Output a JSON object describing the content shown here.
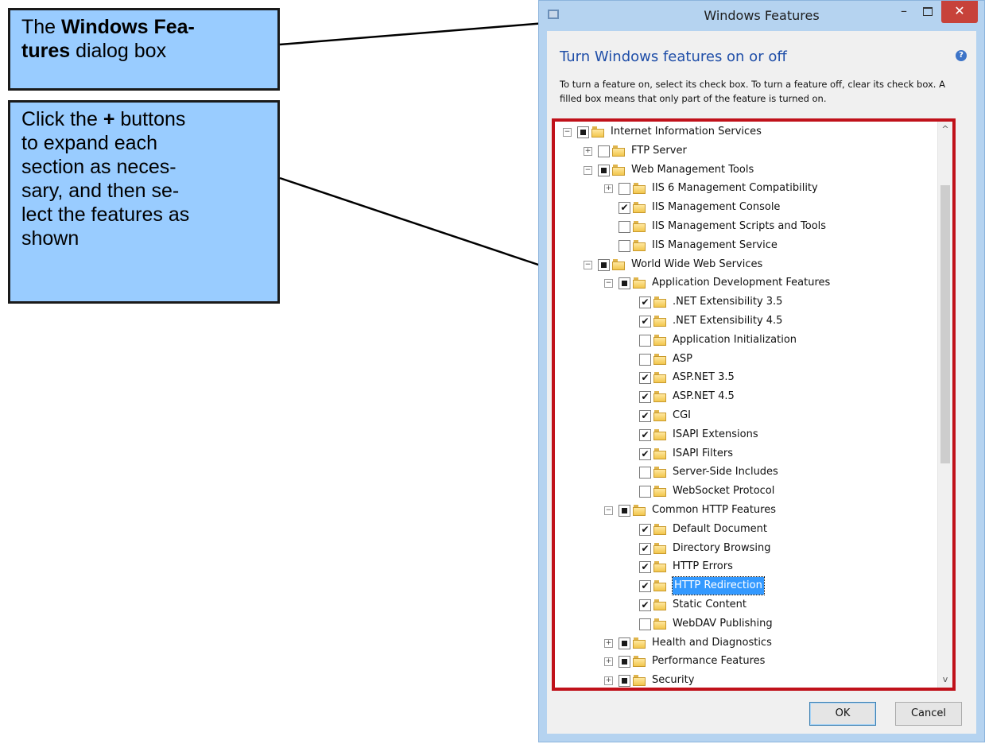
{
  "callouts": [
    {
      "pre": "The ",
      "bold": "Windows Fea-",
      "line2_bold": "tures",
      "post": " dialog box"
    },
    {
      "pre": "Click the ",
      "bold": "+",
      "post": " buttons",
      "lines": [
        "to expand each",
        "section as neces-",
        "sary, and then se-",
        "lect the features as",
        "shown"
      ]
    }
  ],
  "window": {
    "title": "Windows Features",
    "minimize_glyph": "–",
    "close_glyph": "✕",
    "heading": "Turn Windows features on or off",
    "help_glyph": "?",
    "description": "To turn a feature on, select its check box. To turn a feature off, clear its check box. A filled box means that only part of the feature is turned on.",
    "ok_label": "OK",
    "cancel_label": "Cancel"
  },
  "scroll": {
    "up": "^",
    "down": "v"
  },
  "tree": [
    {
      "label": "Internet Information Services",
      "level": 0,
      "expander": "−",
      "check": "partial"
    },
    {
      "label": "FTP Server",
      "level": 1,
      "expander": "+",
      "check": "unchecked"
    },
    {
      "label": "Web Management Tools",
      "level": 1,
      "expander": "−",
      "check": "partial"
    },
    {
      "label": "IIS 6 Management Compatibility",
      "level": 2,
      "expander": "+",
      "check": "unchecked"
    },
    {
      "label": "IIS Management Console",
      "level": 2,
      "expander": "",
      "check": "checked"
    },
    {
      "label": "IIS Management Scripts and Tools",
      "level": 2,
      "expander": "",
      "check": "unchecked"
    },
    {
      "label": "IIS Management Service",
      "level": 2,
      "expander": "",
      "check": "unchecked"
    },
    {
      "label": "World Wide Web Services",
      "level": 1,
      "expander": "−",
      "check": "partial"
    },
    {
      "label": "Application Development Features",
      "level": 2,
      "expander": "−",
      "check": "partial"
    },
    {
      "label": ".NET Extensibility 3.5",
      "level": 3,
      "expander": "",
      "check": "checked"
    },
    {
      "label": ".NET Extensibility 4.5",
      "level": 3,
      "expander": "",
      "check": "checked"
    },
    {
      "label": "Application Initialization",
      "level": 3,
      "expander": "",
      "check": "unchecked"
    },
    {
      "label": "ASP",
      "level": 3,
      "expander": "",
      "check": "unchecked"
    },
    {
      "label": "ASP.NET 3.5",
      "level": 3,
      "expander": "",
      "check": "checked"
    },
    {
      "label": "ASP.NET 4.5",
      "level": 3,
      "expander": "",
      "check": "checked"
    },
    {
      "label": "CGI",
      "level": 3,
      "expander": "",
      "check": "checked"
    },
    {
      "label": "ISAPI Extensions",
      "level": 3,
      "expander": "",
      "check": "checked"
    },
    {
      "label": "ISAPI Filters",
      "level": 3,
      "expander": "",
      "check": "checked"
    },
    {
      "label": "Server-Side Includes",
      "level": 3,
      "expander": "",
      "check": "unchecked"
    },
    {
      "label": "WebSocket Protocol",
      "level": 3,
      "expander": "",
      "check": "unchecked"
    },
    {
      "label": "Common HTTP Features",
      "level": 2,
      "expander": "−",
      "check": "partial"
    },
    {
      "label": "Default Document",
      "level": 3,
      "expander": "",
      "check": "checked"
    },
    {
      "label": "Directory Browsing",
      "level": 3,
      "expander": "",
      "check": "checked"
    },
    {
      "label": "HTTP Errors",
      "level": 3,
      "expander": "",
      "check": "checked"
    },
    {
      "label": "HTTP Redirection",
      "level": 3,
      "expander": "",
      "check": "checked",
      "selected": true
    },
    {
      "label": "Static Content",
      "level": 3,
      "expander": "",
      "check": "checked"
    },
    {
      "label": "WebDAV Publishing",
      "level": 3,
      "expander": "",
      "check": "unchecked"
    },
    {
      "label": "Health and Diagnostics",
      "level": 2,
      "expander": "+",
      "check": "partial"
    },
    {
      "label": "Performance Features",
      "level": 2,
      "expander": "+",
      "check": "partial"
    },
    {
      "label": "Security",
      "level": 2,
      "expander": "+",
      "check": "partial"
    }
  ],
  "colors": {
    "callout_fill": "#99ccff",
    "highlight_border": "#c0111a",
    "selection": "#3399ff",
    "close_button": "#c7423a"
  }
}
